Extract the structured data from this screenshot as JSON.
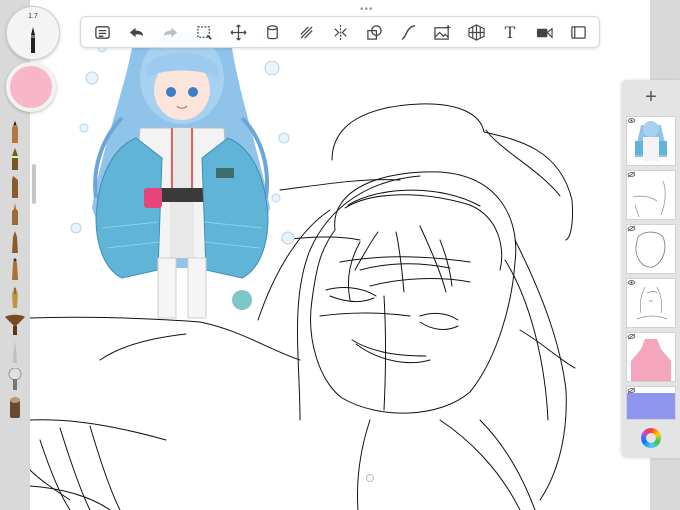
{
  "brush_panel": {
    "size_label": "1.7",
    "current_color": "#f7b7c8",
    "brushes": [
      "pencil",
      "ink-pen",
      "chisel-marker",
      "technical-pen",
      "felt-tip",
      "airbrush",
      "fountain-pen",
      "fan-brush",
      "fine-liner",
      "round-brush",
      "smudge-stump"
    ]
  },
  "toolbar": {
    "items": [
      "menu-icon",
      "undo-icon",
      "redo-icon",
      "selection-icon",
      "transform-icon",
      "fill-icon",
      "guides-icon",
      "symmetry-icon",
      "shapes-icon",
      "curve-icon",
      "image-import-icon",
      "perspective-icon",
      "text-tool",
      "video-icon",
      "fullscreen-icon"
    ],
    "text_tool_label": "T"
  },
  "layers_panel": {
    "add_label": "+",
    "layer_count": 6,
    "layers": [
      {
        "kind": "reference-image"
      },
      {
        "kind": "line-sketch"
      },
      {
        "kind": "head-circle-sketch"
      },
      {
        "kind": "character-sketch"
      },
      {
        "kind": "pink-fill",
        "color": "#f6a6bc"
      },
      {
        "kind": "blue-fill",
        "color": "#8f96ee"
      }
    ]
  },
  "colors": {
    "accent_pink": "#f7b7c8",
    "layer_pink": "#f6a6bc",
    "layer_blue": "#8f96ee",
    "chrome": "#d9d9d9"
  }
}
